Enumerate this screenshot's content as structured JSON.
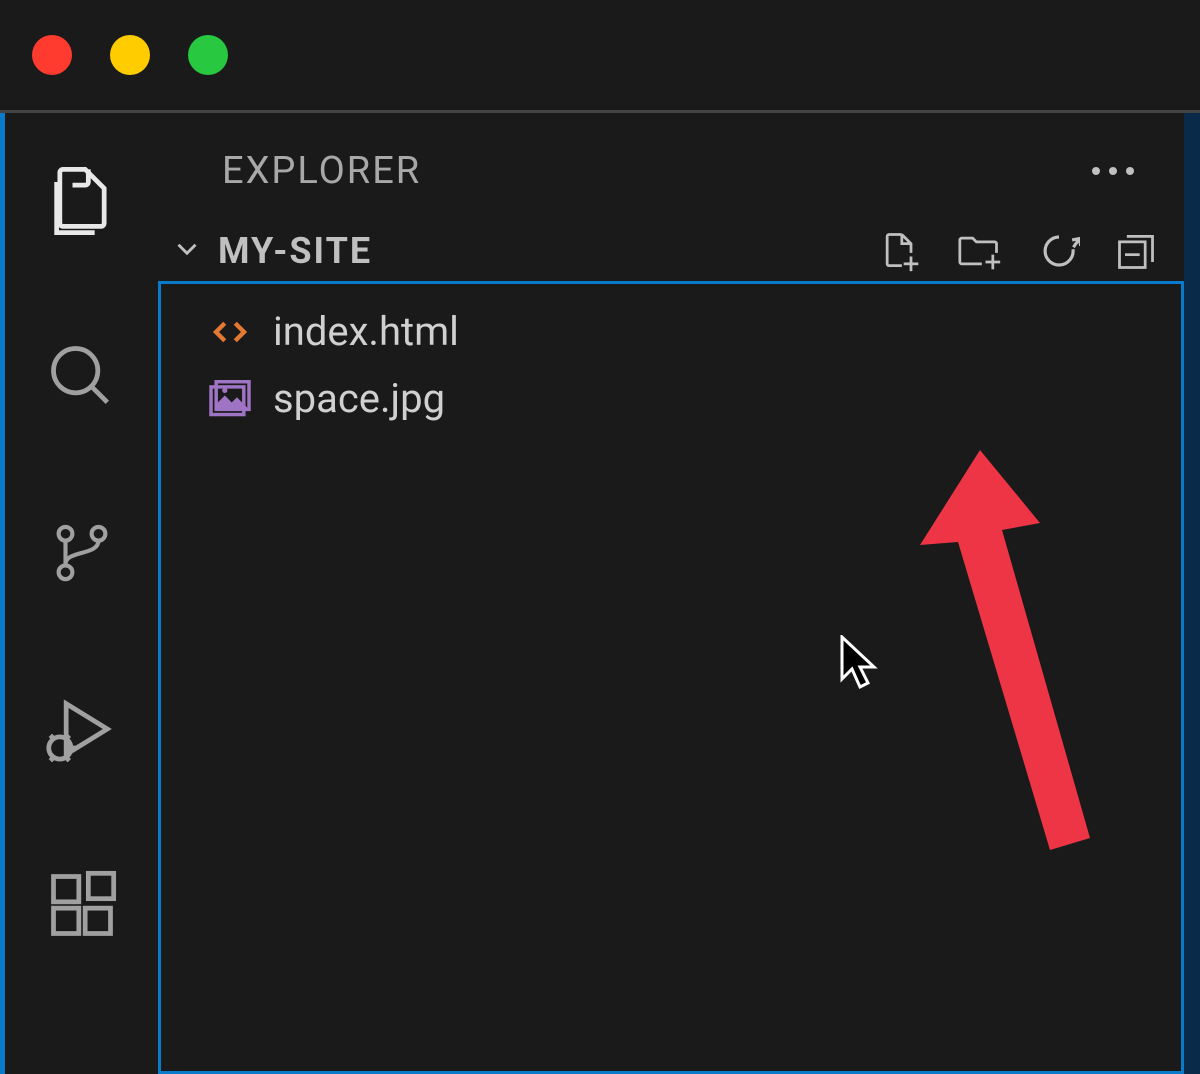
{
  "sidebar": {
    "title": "EXPLORER",
    "folder_name": "MY-SITE",
    "files": [
      {
        "name": "index.html",
        "icon": "html-icon"
      },
      {
        "name": "space.jpg",
        "icon": "image-icon"
      }
    ]
  },
  "icons": {
    "files": "files-icon",
    "search": "search-icon",
    "source_control": "source-control-icon",
    "debug": "debug-icon",
    "extensions": "extensions-icon",
    "more": "more-icon",
    "new_file": "new-file-icon",
    "new_folder": "new-folder-icon",
    "refresh": "refresh-icon",
    "collapse": "collapse-all-icon"
  },
  "colors": {
    "accent": "#0a7aca",
    "html_icon": "#e37933",
    "image_icon": "#a074c4",
    "annotation": "#ed3545"
  }
}
